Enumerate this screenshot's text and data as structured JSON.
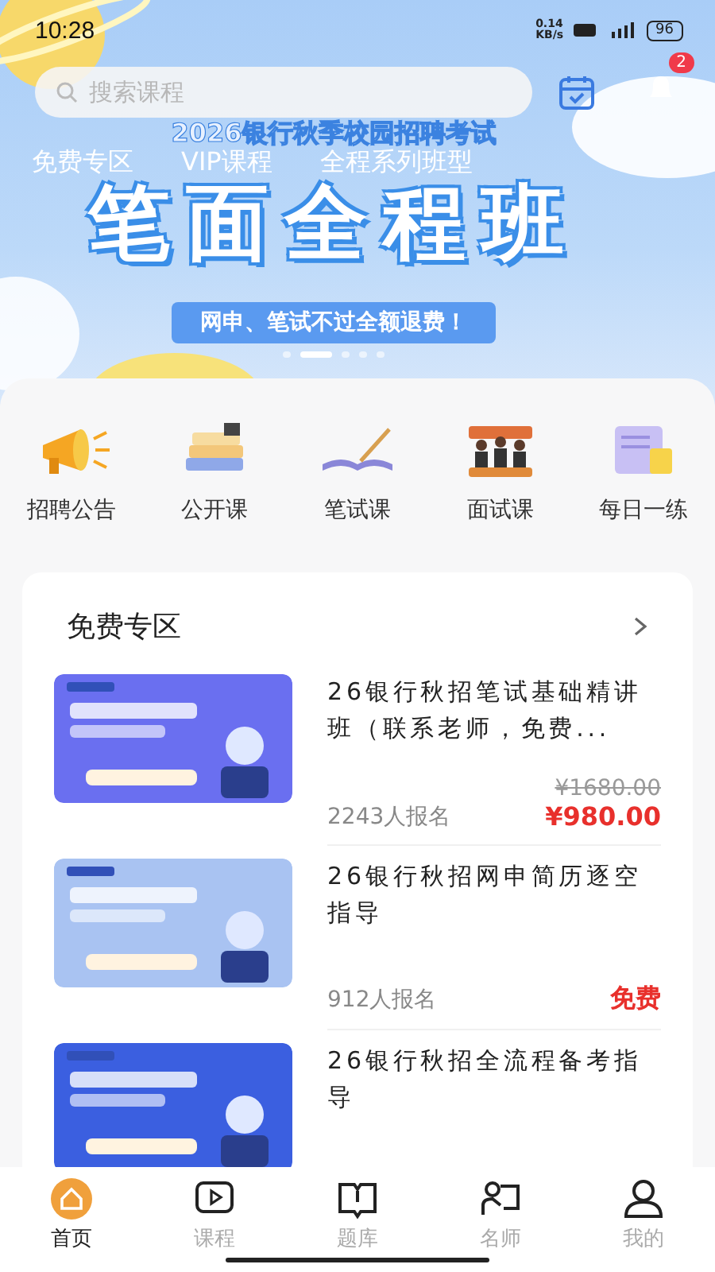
{
  "status_bar": {
    "time": "10:28",
    "speed_value": "0.14",
    "speed_unit": "KB/s",
    "battery": "96"
  },
  "search": {
    "placeholder": "搜索课程"
  },
  "notifications": {
    "badge": "2"
  },
  "banner": {
    "subtitle": "2026银行秋季校园招聘考试",
    "tabs": [
      "免费专区",
      "VIP课程",
      "全程系列班型"
    ],
    "headline": "笔面全程班",
    "ribbon": "网申、笔试不过全额退费！",
    "dots": [
      {
        "selected": false
      },
      {
        "selected": true
      },
      {
        "selected": false
      },
      {
        "selected": false
      },
      {
        "selected": false
      }
    ]
  },
  "categories": [
    {
      "kind": "megaphone",
      "label": "招聘公告"
    },
    {
      "kind": "books",
      "label": "公开课"
    },
    {
      "kind": "notebook",
      "label": "笔试课"
    },
    {
      "kind": "people",
      "label": "面试课"
    },
    {
      "kind": "scroll",
      "label": "每日一练"
    }
  ],
  "section": {
    "title": "免费专区"
  },
  "courses": [
    {
      "title": "26银行秋招笔试基础精讲班（联系老师，免费...",
      "original_price": "¥1680.00",
      "enrolled": "2243人报名",
      "price": "¥980.00"
    },
    {
      "title": "26银行秋招网申简历逐空指导",
      "enrolled": "912人报名",
      "price": "免费"
    },
    {
      "title": "26银行秋招全流程备考指导"
    }
  ],
  "nav": [
    {
      "kind": "home",
      "label": "首页",
      "selected": true
    },
    {
      "kind": "play",
      "label": "课程",
      "selected": false
    },
    {
      "kind": "book",
      "label": "题库",
      "selected": false
    },
    {
      "kind": "teacher",
      "label": "名师",
      "selected": false
    },
    {
      "kind": "user",
      "label": "我的",
      "selected": false
    }
  ]
}
